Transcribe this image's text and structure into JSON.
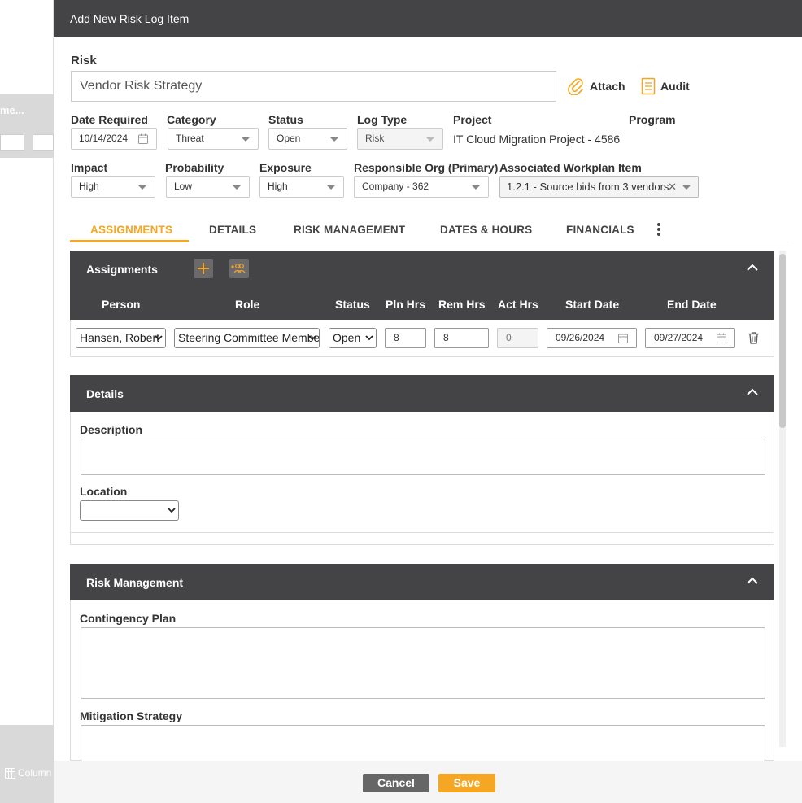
{
  "background": {
    "band_label": "me...",
    "bottom_button_label": "Column"
  },
  "modal": {
    "title": "Add New Risk Log Item",
    "risk_label": "Risk",
    "risk_value": "Vendor Risk Strategy",
    "attach_label": "Attach",
    "audit_label": "Audit",
    "fields": {
      "date_required": {
        "label": "Date Required",
        "value": "10/14/2024"
      },
      "category": {
        "label": "Category",
        "value": "Threat"
      },
      "status": {
        "label": "Status",
        "value": "Open"
      },
      "log_type": {
        "label": "Log Type",
        "value": "Risk"
      },
      "project": {
        "label": "Project",
        "value": "IT Cloud Migration Project - 4586"
      },
      "program": {
        "label": "Program",
        "value": ""
      },
      "impact": {
        "label": "Impact",
        "value": "High"
      },
      "probability": {
        "label": "Probability",
        "value": "Low"
      },
      "exposure": {
        "label": "Exposure",
        "value": "High"
      },
      "responsible_org": {
        "label": "Responsible Org (Primary)",
        "value": "Company - 362"
      },
      "workplan_item": {
        "label": "Associated Workplan Item",
        "value": "1.2.1 - Source bids from 3 vendors"
      }
    },
    "tabs": [
      "ASSIGNMENTS",
      "DETAILS",
      "RISK MANAGEMENT",
      "DATES & HOURS",
      "FINANCIALS"
    ],
    "active_tab": "ASSIGNMENTS",
    "assignments": {
      "title": "Assignments",
      "columns": [
        "Person",
        "Role",
        "Status",
        "Pln Hrs",
        "Rem Hrs",
        "Act Hrs",
        "Start Date",
        "End Date"
      ],
      "rows": [
        {
          "person": "Hansen, Robert",
          "role": "Steering Committee Member",
          "status": "Open",
          "pln_hrs": "8",
          "rem_hrs": "8",
          "act_hrs": "0",
          "start_date": "09/26/2024",
          "end_date": "09/27/2024"
        }
      ]
    },
    "details": {
      "title": "Details",
      "description_label": "Description",
      "description_value": "",
      "location_label": "Location",
      "location_value": ""
    },
    "risk_management": {
      "title": "Risk Management",
      "contingency_label": "Contingency Plan",
      "mitigation_label": "Mitigation Strategy"
    },
    "footer": {
      "cancel_label": "Cancel",
      "save_label": "Save"
    }
  },
  "colors": {
    "header_bg": "#444446",
    "accent": "#f5a623",
    "cancel_bg": "#666666"
  }
}
